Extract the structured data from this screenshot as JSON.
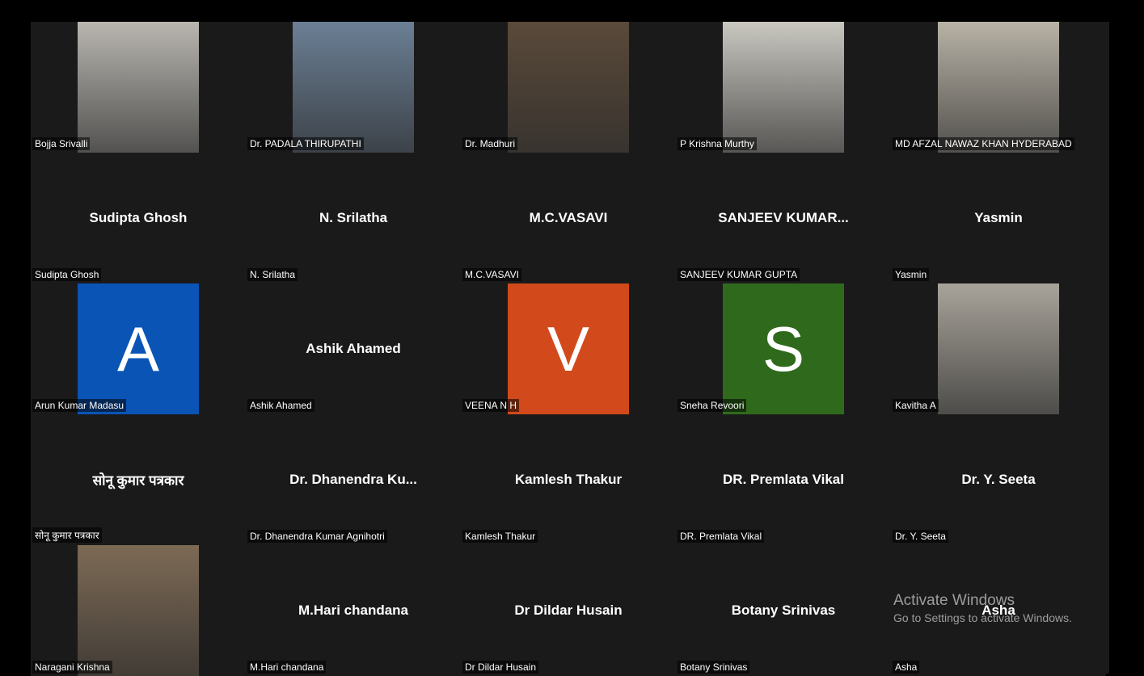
{
  "participants": [
    {
      "name": "Bojja Srivalli",
      "display": "",
      "kind": "video",
      "bg": "#b9b6b0"
    },
    {
      "name": "Dr. PADALA THIRUPATHI",
      "display": "",
      "kind": "video",
      "bg": "#6b7f95"
    },
    {
      "name": "Dr. Madhuri",
      "display": "",
      "kind": "video",
      "bg": "#5a4a3a"
    },
    {
      "name": "P Krishna Murthy",
      "display": "",
      "kind": "video",
      "bg": "#c9c7c0"
    },
    {
      "name": "MD AFZAL NAWAZ KHAN HYDERABAD",
      "display": "",
      "kind": "video",
      "bg": "#b8b2a6"
    },
    {
      "name": "Sudipta Ghosh",
      "display": "Sudipta Ghosh",
      "kind": "name"
    },
    {
      "name": "N. Srilatha",
      "display": "N. Srilatha",
      "kind": "name"
    },
    {
      "name": "M.C.VASAVI",
      "display": "M.C.VASAVI",
      "kind": "name"
    },
    {
      "name": "SANJEEV KUMAR GUPTA",
      "display": "SANJEEV  KUMAR...",
      "kind": "name"
    },
    {
      "name": "Yasmin",
      "display": "Yasmin",
      "kind": "name"
    },
    {
      "name": "Arun Kumar Madasu",
      "display": "A",
      "kind": "avatar",
      "bg": "#0a54b6"
    },
    {
      "name": "Ashik Ahamed",
      "display": "Ashik Ahamed",
      "kind": "name"
    },
    {
      "name": "VEENA N H",
      "display": "V",
      "kind": "avatar",
      "bg": "#d24a1c"
    },
    {
      "name": "Sneha Revoori",
      "display": "S",
      "kind": "avatar",
      "bg": "#2f6a1c"
    },
    {
      "name": "Kavitha A",
      "display": "",
      "kind": "video",
      "bg": "#a8a39a"
    },
    {
      "name": "सोनू कुमार पत्रकार",
      "display": "सोनू कुमार पत्रकार",
      "kind": "name"
    },
    {
      "name": "Dr. Dhanendra Kumar Agnihotri",
      "display": "Dr. Dhanendra  Ku...",
      "kind": "name"
    },
    {
      "name": "Kamlesh Thakur",
      "display": "Kamlesh Thakur",
      "kind": "name"
    },
    {
      "name": "DR. Premlata Vikal",
      "display": "DR. Premlata Vikal",
      "kind": "name"
    },
    {
      "name": "Dr. Y. Seeta",
      "display": "Dr. Y. Seeta",
      "kind": "name"
    },
    {
      "name": "Naragani Krishna",
      "display": "",
      "kind": "video",
      "bg": "#7d6a55"
    },
    {
      "name": "M.Hari chandana",
      "display": "M.Hari chandana",
      "kind": "name"
    },
    {
      "name": "Dr Dildar Husain",
      "display": "Dr Dildar Husain",
      "kind": "name"
    },
    {
      "name": "Botany Srinivas",
      "display": "Botany Srinivas",
      "kind": "name"
    },
    {
      "name": "Asha",
      "display": "Asha",
      "kind": "name"
    }
  ],
  "watermark": {
    "title": "Activate Windows",
    "subtitle": "Go to Settings to activate Windows."
  }
}
